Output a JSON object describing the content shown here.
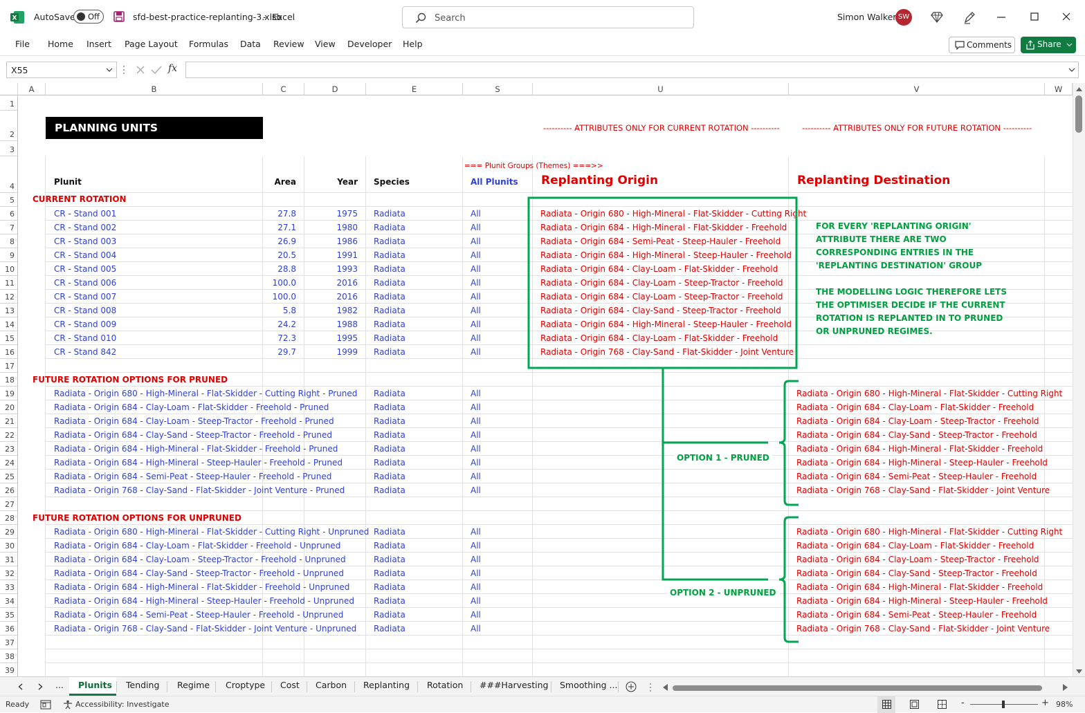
{
  "titlebar": {
    "autosave_label": "AutoSave",
    "autosave_state": "Off",
    "filename": "sfd-best-practice-replanting-3.xlsb",
    "separator": "-",
    "app": "Excel",
    "search_placeholder": "Search",
    "user_name": "Simon Walker",
    "user_initials": "SW",
    "icons": [
      "excel-logo-icon",
      "save-icon",
      "search-icon",
      "diamond-icon",
      "pen-icon",
      "minimize-icon",
      "maximize-icon",
      "close-icon"
    ]
  },
  "ribbon": {
    "tabs": [
      "File",
      "Home",
      "Insert",
      "Page Layout",
      "Formulas",
      "Data",
      "Review",
      "View",
      "Developer",
      "Help"
    ],
    "comments_label": "Comments",
    "share_label": "Share"
  },
  "formula_bar": {
    "name_box": "X55",
    "fx_label": "fx",
    "formula": ""
  },
  "columns": [
    "A",
    "B",
    "C",
    "D",
    "E",
    "S",
    "U",
    "V",
    "W"
  ],
  "rows": [
    "1",
    "2",
    "3",
    "4",
    "5",
    "6",
    "7",
    "8",
    "9",
    "10",
    "11",
    "12",
    "13",
    "14",
    "15",
    "16",
    "17",
    "18",
    "19",
    "20",
    "21",
    "22",
    "23",
    "24",
    "25",
    "26",
    "27",
    "28",
    "29",
    "30",
    "31",
    "32",
    "33",
    "34",
    "35",
    "36",
    "37",
    "38",
    "39"
  ],
  "sheet": {
    "title": "PLANNING UNITS",
    "attr_current": "---------- ATTRIBUTES ONLY FOR CURRENT ROTATION ----------",
    "attr_future": "---------- ATTRIBUTES ONLY FOR FUTURE ROTATION ----------",
    "groups_label": "=== Plunit Groups (Themes) ===>>",
    "headers": {
      "plunit": "Plunit",
      "area": "Area",
      "year": "Year",
      "species": "Species",
      "all_plunits": "All Plunits",
      "replanting_origin": "Replanting Origin",
      "replanting_destination": "Replanting Destination"
    },
    "section_current": "CURRENT ROTATION",
    "section_pruned": "FUTURE ROTATION OPTIONS FOR PRUNED",
    "section_unpruned": "FUTURE ROTATION OPTIONS FOR UNPRUNED",
    "current_rows": [
      {
        "plunit": "CR - Stand 001",
        "area": "27.8",
        "year": "1975",
        "species": "Radiata",
        "all": "All",
        "origin": "Radiata - Origin 680 - High-Mineral - Flat-Skidder - Cutting Right"
      },
      {
        "plunit": "CR - Stand 002",
        "area": "27.1",
        "year": "1980",
        "species": "Radiata",
        "all": "All",
        "origin": "Radiata - Origin 684 - High-Mineral - Flat-Skidder - Freehold"
      },
      {
        "plunit": "CR - Stand 003",
        "area": "26.9",
        "year": "1986",
        "species": "Radiata",
        "all": "All",
        "origin": "Radiata - Origin 684 - Semi-Peat - Steep-Hauler - Freehold"
      },
      {
        "plunit": "CR - Stand 004",
        "area": "20.5",
        "year": "1991",
        "species": "Radiata",
        "all": "All",
        "origin": "Radiata - Origin 684 - High-Mineral - Steep-Hauler - Freehold"
      },
      {
        "plunit": "CR - Stand 005",
        "area": "28.8",
        "year": "1993",
        "species": "Radiata",
        "all": "All",
        "origin": "Radiata - Origin 684 - Clay-Loam - Flat-Skidder - Freehold"
      },
      {
        "plunit": "CR - Stand 006",
        "area": "100.0",
        "year": "2016",
        "species": "Radiata",
        "all": "All",
        "origin": "Radiata - Origin 684 - Clay-Loam - Steep-Tractor - Freehold"
      },
      {
        "plunit": "CR - Stand 007",
        "area": "100.0",
        "year": "2016",
        "species": "Radiata",
        "all": "All",
        "origin": "Radiata - Origin 684 - Clay-Loam - Steep-Tractor - Freehold"
      },
      {
        "plunit": "CR - Stand 008",
        "area": "5.8",
        "year": "1982",
        "species": "Radiata",
        "all": "All",
        "origin": "Radiata - Origin 684 - Clay-Sand - Steep-Tractor - Freehold"
      },
      {
        "plunit": "CR - Stand 009",
        "area": "24.2",
        "year": "1988",
        "species": "Radiata",
        "all": "All",
        "origin": "Radiata - Origin 684 - High-Mineral - Steep-Hauler - Freehold"
      },
      {
        "plunit": "CR - Stand 010",
        "area": "72.3",
        "year": "1995",
        "species": "Radiata",
        "all": "All",
        "origin": "Radiata - Origin 684 - Clay-Loam - Flat-Skidder - Freehold"
      },
      {
        "plunit": "CR - Stand 842",
        "area": "29.7",
        "year": "1999",
        "species": "Radiata",
        "all": "All",
        "origin": "Radiata - Origin 768 - Clay-Sand - Flat-Skidder - Joint Venture"
      }
    ],
    "pruned_rows": [
      {
        "plunit": "Radiata - Origin 680 - High-Mineral - Flat-Skidder - Cutting Right - Pruned",
        "species": "Radiata",
        "all": "All",
        "dest": "Radiata - Origin 680 - High-Mineral - Flat-Skidder - Cutting Right"
      },
      {
        "plunit": "Radiata - Origin 684 - Clay-Loam - Flat-Skidder - Freehold - Pruned",
        "species": "Radiata",
        "all": "All",
        "dest": "Radiata - Origin 684 - Clay-Loam - Flat-Skidder - Freehold"
      },
      {
        "plunit": "Radiata - Origin 684 - Clay-Loam - Steep-Tractor - Freehold - Pruned",
        "species": "Radiata",
        "all": "All",
        "dest": "Radiata - Origin 684 - Clay-Loam - Steep-Tractor - Freehold"
      },
      {
        "plunit": "Radiata - Origin 684 - Clay-Sand - Steep-Tractor - Freehold - Pruned",
        "species": "Radiata",
        "all": "All",
        "dest": "Radiata - Origin 684 - Clay-Sand - Steep-Tractor - Freehold"
      },
      {
        "plunit": "Radiata - Origin 684 - High-Mineral - Flat-Skidder - Freehold - Pruned",
        "species": "Radiata",
        "all": "All",
        "dest": "Radiata - Origin 684 - High-Mineral - Flat-Skidder - Freehold"
      },
      {
        "plunit": "Radiata - Origin 684 - High-Mineral - Steep-Hauler - Freehold - Pruned",
        "species": "Radiata",
        "all": "All",
        "dest": "Radiata - Origin 684 - High-Mineral - Steep-Hauler - Freehold"
      },
      {
        "plunit": "Radiata - Origin 684 - Semi-Peat - Steep-Hauler - Freehold - Pruned",
        "species": "Radiata",
        "all": "All",
        "dest": "Radiata - Origin 684 - Semi-Peat - Steep-Hauler - Freehold"
      },
      {
        "plunit": "Radiata - Origin 768 - Clay-Sand - Flat-Skidder - Joint Venture - Pruned",
        "species": "Radiata",
        "all": "All",
        "dest": "Radiata - Origin 768 - Clay-Sand - Flat-Skidder - Joint Venture"
      }
    ],
    "unpruned_rows": [
      {
        "plunit": "Radiata - Origin 680 - High-Mineral - Flat-Skidder - Cutting Right - Unpruned",
        "species": "Radiata",
        "all": "All",
        "dest": "Radiata - Origin 680 - High-Mineral - Flat-Skidder - Cutting Right"
      },
      {
        "plunit": "Radiata - Origin 684 - Clay-Loam - Flat-Skidder - Freehold - Unpruned",
        "species": "Radiata",
        "all": "All",
        "dest": "Radiata - Origin 684 - Clay-Loam - Flat-Skidder - Freehold"
      },
      {
        "plunit": "Radiata - Origin 684 - Clay-Loam - Steep-Tractor - Freehold - Unpruned",
        "species": "Radiata",
        "all": "All",
        "dest": "Radiata - Origin 684 - Clay-Loam - Steep-Tractor - Freehold"
      },
      {
        "plunit": "Radiata - Origin 684 - Clay-Sand - Steep-Tractor - Freehold - Unpruned",
        "species": "Radiata",
        "all": "All",
        "dest": "Radiata - Origin 684 - Clay-Sand - Steep-Tractor - Freehold"
      },
      {
        "plunit": "Radiata - Origin 684 - High-Mineral - Flat-Skidder - Freehold - Unpruned",
        "species": "Radiata",
        "all": "All",
        "dest": "Radiata - Origin 684 - High-Mineral - Flat-Skidder - Freehold"
      },
      {
        "plunit": "Radiata - Origin 684 - High-Mineral - Steep-Hauler - Freehold - Unpruned",
        "species": "Radiata",
        "all": "All",
        "dest": "Radiata - Origin 684 - High-Mineral - Steep-Hauler - Freehold"
      },
      {
        "plunit": "Radiata - Origin 684 - Semi-Peat - Steep-Hauler - Freehold - Unpruned",
        "species": "Radiata",
        "all": "All",
        "dest": "Radiata - Origin 684 - Semi-Peat - Steep-Hauler - Freehold"
      },
      {
        "plunit": "Radiata - Origin 768 - Clay-Sand - Flat-Skidder - Joint Venture - Unpruned",
        "species": "Radiata",
        "all": "All",
        "dest": "Radiata - Origin 768 - Clay-Sand - Flat-Skidder - Joint Venture"
      }
    ],
    "note_lines": [
      "FOR EVERY 'REPLANTING ORIGIN'",
      "ATTRIBUTE THERE ARE TWO",
      "CORRESPONDING ENTRIES IN THE",
      "'REPLANTING DESTINATION' GROUP",
      "",
      "THE MODELLING LOGIC THEREFORE LETS",
      "THE OPTIMISER DECIDE IF THE CURRENT",
      "ROTATION IS REPLANTED IN TO PRUNED",
      "OR UNPRUNED REGIMES."
    ],
    "option1": "OPTION 1 - PRUNED",
    "option2": "OPTION 2 - UNPRUNED"
  },
  "sheet_tabs": {
    "ellipsis": "...",
    "tabs": [
      "Plunits",
      "Tending",
      "Regime",
      "Croptype",
      "Cost",
      "Carbon",
      "Replanting",
      "Rotation",
      "###Harvesting",
      "Smoothing ..."
    ],
    "active": "Plunits"
  },
  "status": {
    "ready": "Ready",
    "accessibility": "Accessibility: Investigate",
    "zoom": "98%",
    "zoom_level": 0.49,
    "minus": "-",
    "plus": "+"
  },
  "colors": {
    "excel_green": "#107c41",
    "link_blue": "#2f3fd6",
    "red_text": "#e00000",
    "annotation_green": "#00a040"
  }
}
